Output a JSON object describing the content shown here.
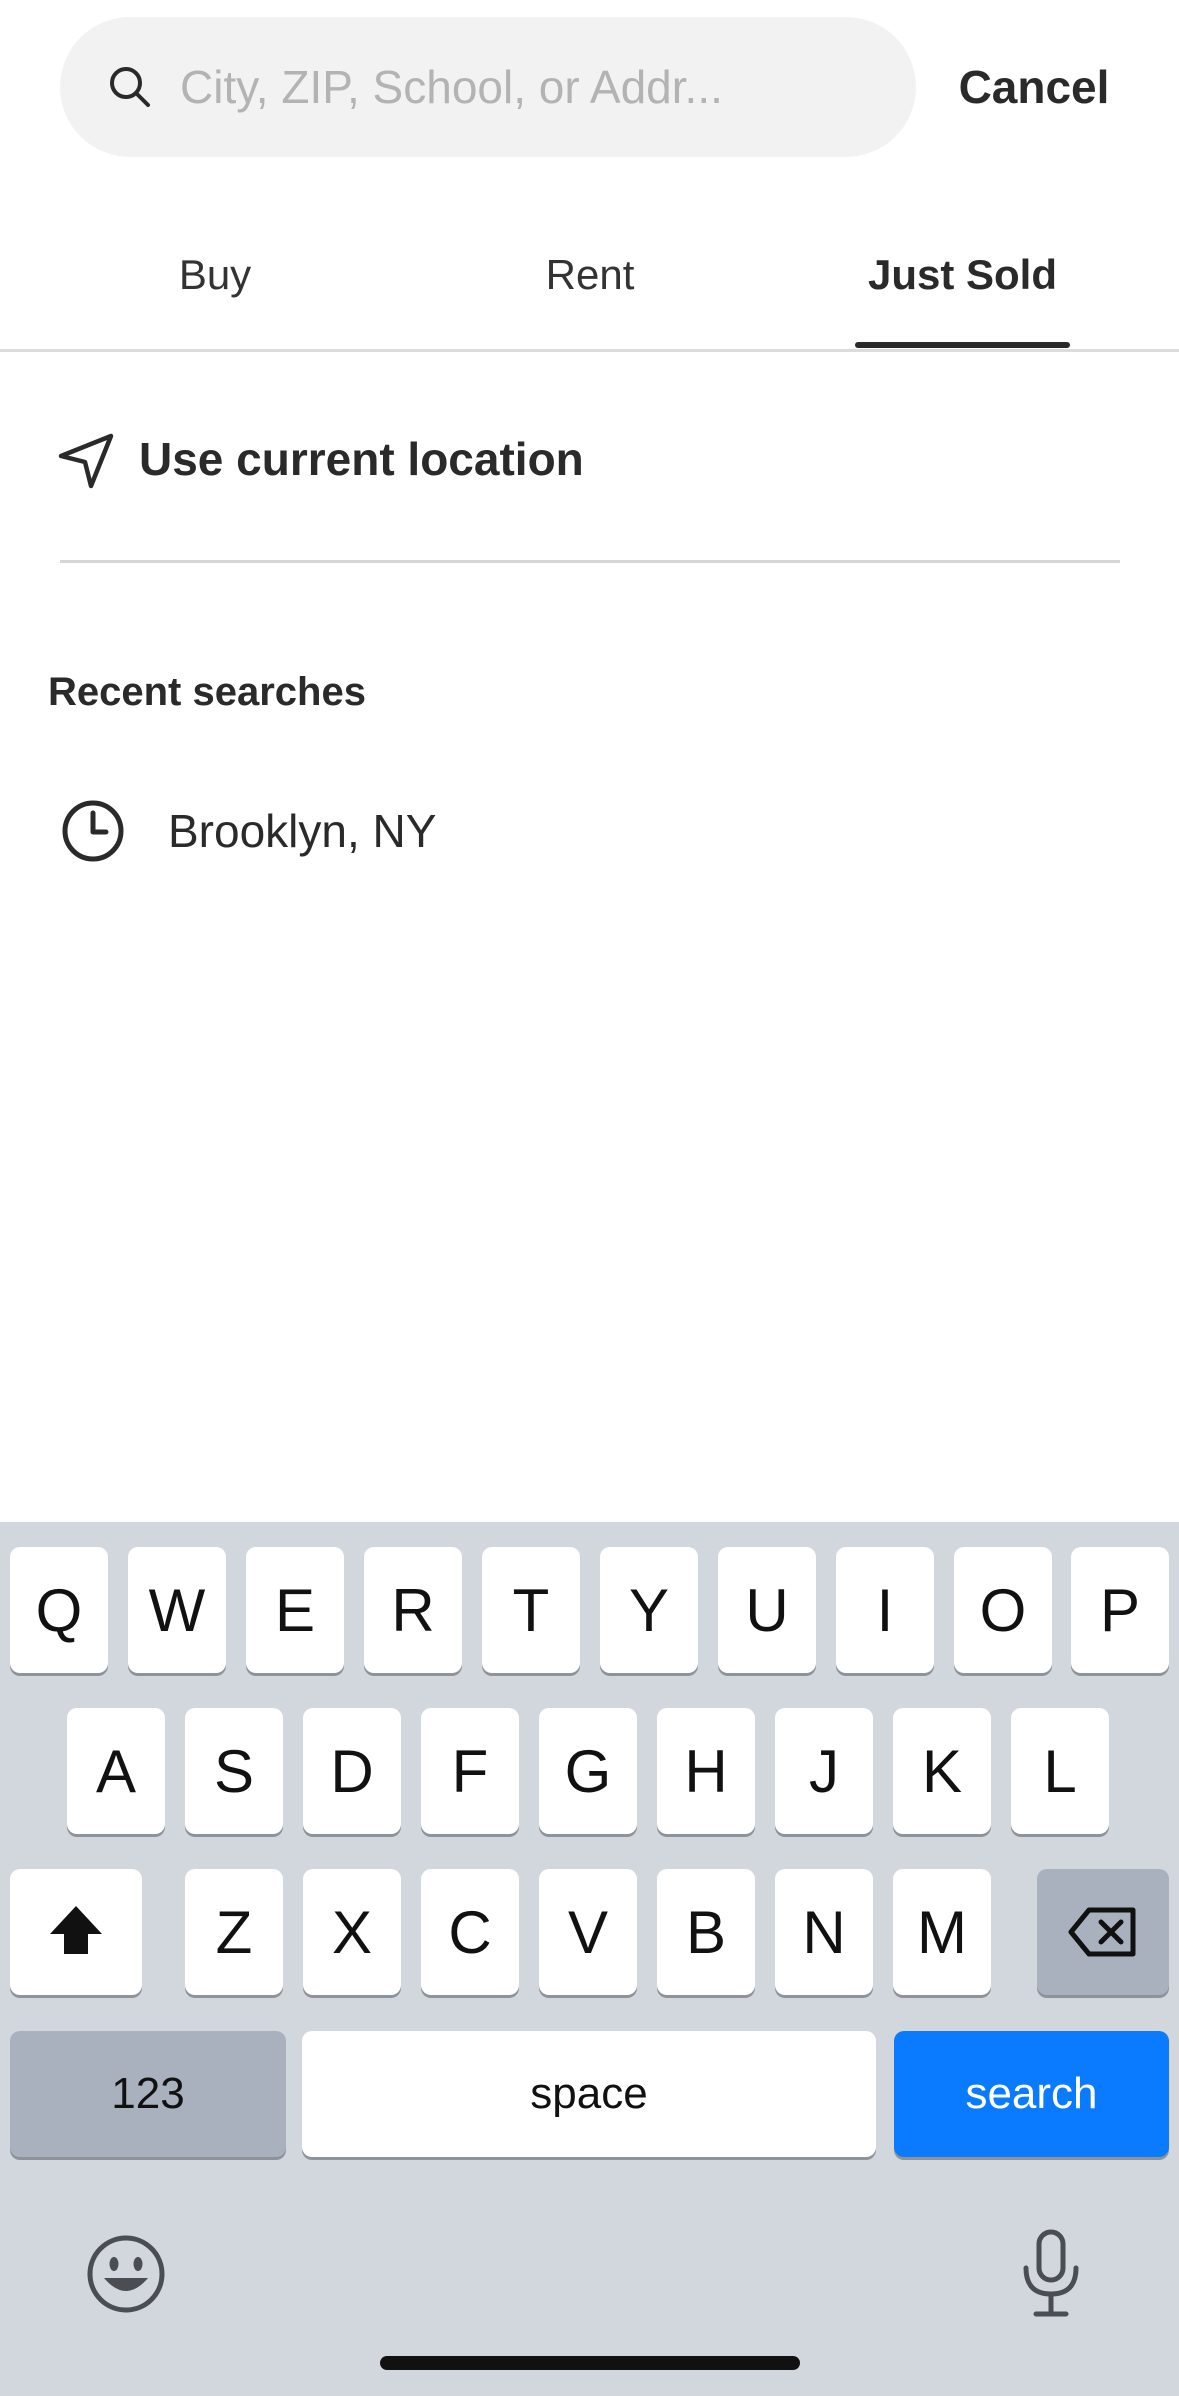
{
  "search": {
    "placeholder": "City, ZIP, School, or Addr...",
    "value": "",
    "cancel_label": "Cancel"
  },
  "tabs": [
    {
      "label": "Buy",
      "active": false
    },
    {
      "label": "Rent",
      "active": false
    },
    {
      "label": "Just Sold",
      "active": true
    }
  ],
  "location": {
    "label": "Use current location",
    "icon": "navigation-arrow-icon"
  },
  "recent": {
    "title": "Recent searches",
    "items": [
      {
        "label": "Brooklyn, NY",
        "icon": "clock-icon"
      }
    ]
  },
  "keyboard": {
    "row1": [
      "Q",
      "W",
      "E",
      "R",
      "T",
      "Y",
      "U",
      "I",
      "O",
      "P"
    ],
    "row2": [
      "A",
      "S",
      "D",
      "F",
      "G",
      "H",
      "J",
      "K",
      "L"
    ],
    "row3": [
      "Z",
      "X",
      "C",
      "V",
      "B",
      "N",
      "M"
    ],
    "numbers_label": "123",
    "space_label": "space",
    "search_label": "search",
    "shift_icon": "shift-icon",
    "delete_icon": "backspace-icon",
    "emoji_icon": "emoji-icon",
    "mic_icon": "microphone-icon"
  },
  "colors": {
    "search_key": "#0a7aff",
    "keyboard_bg": "#d2d6dd",
    "search_field_bg": "#f2f2f2"
  }
}
